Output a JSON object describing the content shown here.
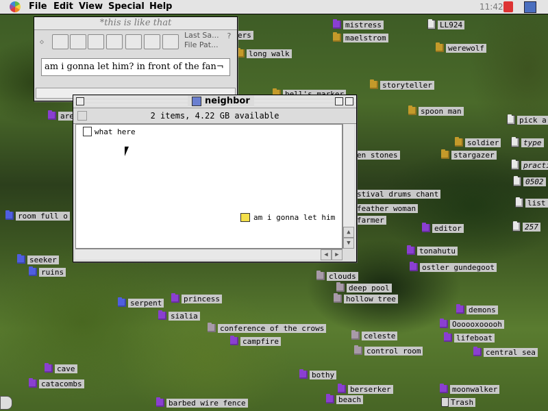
{
  "menubar": {
    "items": [
      "File",
      "Edit",
      "View",
      "Special",
      "Help"
    ],
    "clock": "11:42"
  },
  "desktop_icons": [
    {
      "label": "mistress",
      "icon": "folder-icon",
      "color": "purple"
    },
    {
      "label": "maelstrom",
      "icon": "folder-icon",
      "color": "gold"
    },
    {
      "label": "LL924",
      "icon": "file-icon",
      "color": "doc"
    },
    {
      "label": "werewolf",
      "icon": "folder-icon",
      "color": "gold"
    },
    {
      "label": "ers",
      "icon": "folder-icon",
      "color": "gold"
    },
    {
      "label": "long walk",
      "icon": "folder-icon",
      "color": "gold"
    },
    {
      "label": "bell's marker",
      "icon": "folder-icon",
      "color": "gold"
    },
    {
      "label": "storyteller",
      "icon": "folder-icon",
      "color": "gold"
    },
    {
      "label": "spoon man",
      "icon": "folder-icon",
      "color": "gold"
    },
    {
      "label": "pick a",
      "icon": "note-icon",
      "color": "doc"
    },
    {
      "label": "soldier",
      "icon": "folder-icon",
      "color": "gold"
    },
    {
      "label": "type",
      "icon": "file-icon",
      "color": "doc"
    },
    {
      "label": "stargazer",
      "icon": "folder-icon",
      "color": "gold"
    },
    {
      "label": "practi",
      "icon": "file-icon",
      "color": "doc"
    },
    {
      "label": "0502",
      "icon": "file-icon",
      "color": "doc"
    },
    {
      "label": "list",
      "icon": "file-icon",
      "color": "doc"
    },
    {
      "label": "257",
      "icon": "file-icon",
      "color": "doc"
    },
    {
      "label": "are",
      "icon": "folder-icon",
      "color": "purple"
    },
    {
      "label": "en stones",
      "icon": "folder-icon",
      "color": "purple"
    },
    {
      "label": "stival drums chant",
      "icon": "folder-icon",
      "color": "purple"
    },
    {
      "label": "feather woman",
      "icon": "folder-icon",
      "color": "purple"
    },
    {
      "label": "farmer",
      "icon": "folder-icon",
      "color": "purple"
    },
    {
      "label": "editor",
      "icon": "folder-icon",
      "color": "purple"
    },
    {
      "label": "room full o",
      "icon": "folder-icon",
      "color": "blue"
    },
    {
      "label": "tonahutu",
      "icon": "folder-icon",
      "color": "purple"
    },
    {
      "label": "seeker",
      "icon": "folder-icon",
      "color": "blue"
    },
    {
      "label": "ostler gundegoot",
      "icon": "folder-icon",
      "color": "purple"
    },
    {
      "label": "ruins",
      "icon": "folder-icon",
      "color": "blue"
    },
    {
      "label": "clouds",
      "icon": "folder-icon",
      "color": "grey"
    },
    {
      "label": "deep pool",
      "icon": "folder-icon",
      "color": "grey"
    },
    {
      "label": "hollow tree",
      "icon": "folder-icon",
      "color": "grey"
    },
    {
      "label": "serpent",
      "icon": "folder-icon",
      "color": "blue"
    },
    {
      "label": "princess",
      "icon": "folder-icon",
      "color": "purple"
    },
    {
      "label": "demons",
      "icon": "folder-icon",
      "color": "purple"
    },
    {
      "label": "sialia",
      "icon": "folder-icon",
      "color": "purple"
    },
    {
      "label": "Oooooxooooh",
      "icon": "folder-icon",
      "color": "purple"
    },
    {
      "label": "conference of the crows",
      "icon": "folder-icon",
      "color": "grey"
    },
    {
      "label": "celeste",
      "icon": "folder-icon",
      "color": "grey"
    },
    {
      "label": "lifeboat",
      "icon": "folder-icon",
      "color": "purple"
    },
    {
      "label": "campfire",
      "icon": "folder-icon",
      "color": "purple"
    },
    {
      "label": "control room",
      "icon": "folder-icon",
      "color": "grey"
    },
    {
      "label": "central sea",
      "icon": "folder-icon",
      "color": "purple"
    },
    {
      "label": "cave",
      "icon": "folder-icon",
      "color": "purple"
    },
    {
      "label": "bothy",
      "icon": "folder-icon",
      "color": "purple"
    },
    {
      "label": "catacombs",
      "icon": "folder-icon",
      "color": "purple"
    },
    {
      "label": "berserker",
      "icon": "folder-icon",
      "color": "purple"
    },
    {
      "label": "moonwalker",
      "icon": "folder-icon",
      "color": "purple"
    },
    {
      "label": "beach",
      "icon": "folder-icon",
      "color": "purple"
    },
    {
      "label": "barbed wire fence",
      "icon": "folder-icon",
      "color": "purple"
    },
    {
      "label": "Trash",
      "icon": "trash-icon",
      "color": "doc"
    }
  ],
  "doc_window": {
    "title": "*this is like that",
    "status_line1": "Last Sa...",
    "status_line2": "File Pat...",
    "text": "am i gonna let him? in front of the fan¬"
  },
  "finder_window": {
    "title": "neighbor",
    "info": "2 items, 4.22 GB available",
    "items": [
      "what here",
      "am i gonna let him"
    ]
  }
}
